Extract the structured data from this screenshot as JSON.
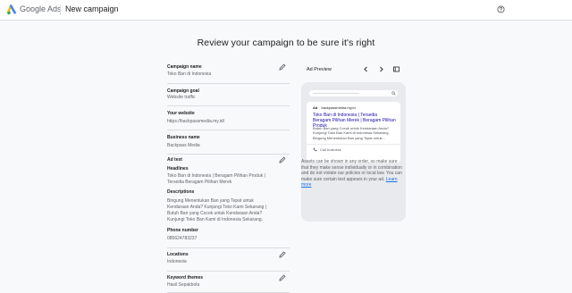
{
  "header": {
    "brand": "Google Ads",
    "breadcrumb": "New campaign",
    "help_icon": "help-icon",
    "logo_colors": [
      "#fbbc04",
      "#4285f4",
      "#34a853"
    ]
  },
  "page_title": "Review your campaign to be sure it's right",
  "summary": {
    "campaign_name": {
      "label": "Campaign name",
      "value": "Toko Ban di Indonesia"
    },
    "campaign_goal": {
      "label": "Campaign goal",
      "value": "Website traffic"
    },
    "website": {
      "label": "Your website",
      "value": "https://backpassmedia.my.id/"
    },
    "business_name": {
      "label": "Business name",
      "value": "Backpass Media"
    },
    "ad_text": {
      "label": "Ad text",
      "headlines_label": "Headlines",
      "headlines": [
        "Toko Ban di Indonesia | Beragam Pilihan Produk |",
        "Tersedia Beragam Pilihan Merek"
      ],
      "descriptions_label": "Descriptions",
      "descriptions": [
        "Bingung Menentukan Ban yang Tepat untuk",
        "Kendaraan Anda? Kunjungi Toko Kami Sekarang |",
        "Butuh Ban yang Cocok untuk Kendaraan Anda?",
        "Kunjungi Toko Ban Kami di Indonesia Sekarang."
      ],
      "phone_label": "Phone number",
      "phone": "085624783237"
    },
    "locations": {
      "label": "Locations",
      "value": "Indonesia"
    },
    "keyword_themes": {
      "label": "Keyword themes",
      "value": "Hasil Sepakbola"
    }
  },
  "preview": {
    "title": "Ad Preview",
    "ad": {
      "label": "Ad",
      "url": "backpassmedia.my.id",
      "headline": "Toko Ban di Indonesia | Tersedia Beragam Pilihan Merek | Beragam Pilihan Produk",
      "description": "Butuh Ban yang Cocok untuk Kendaraan Anda? Kunjungi Toko Ban Kami di Indonesia Sekarang. Bingung Menentukan Ban yang Tepat untuk...",
      "call_text": "Call business"
    },
    "note": "Assets can be shown in any order, so make sure that they make sense individually or in combination and do not violate our policies or local law. You can make sure certain text appears in your ad.",
    "learn_more": "Learn more"
  }
}
